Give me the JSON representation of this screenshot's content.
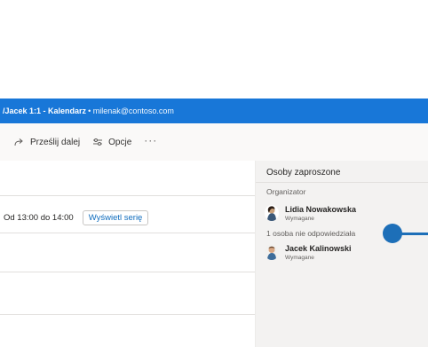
{
  "window": {
    "title": "/Jacek 1:1 - Kalendarz",
    "email": "• milenak@contoso.com"
  },
  "toolbar": {
    "forward_label": "Prześlij dalej",
    "forward_icon": "forward-arrow-icon",
    "options_label": "Opcje",
    "options_icon": "sliders-icon",
    "more_label": "···"
  },
  "details": {
    "time_text": "Od 13:00 do 14:00",
    "view_series_label": "Wyświetl serię"
  },
  "attendees": {
    "heading": "Osoby zaproszone",
    "organizer_section": "Organizator",
    "organizer": {
      "name": "Lidia Nowakowska",
      "role": "Wymagane"
    },
    "no_response_section": "1 osoba nie odpowiedziała",
    "no_response": [
      {
        "name": "Jacek Kalinowski",
        "role": "Wymagane"
      }
    ]
  },
  "colors": {
    "titlebar": "#1877d8",
    "accent": "#0f6cbd",
    "callout": "#1d6fb8"
  }
}
